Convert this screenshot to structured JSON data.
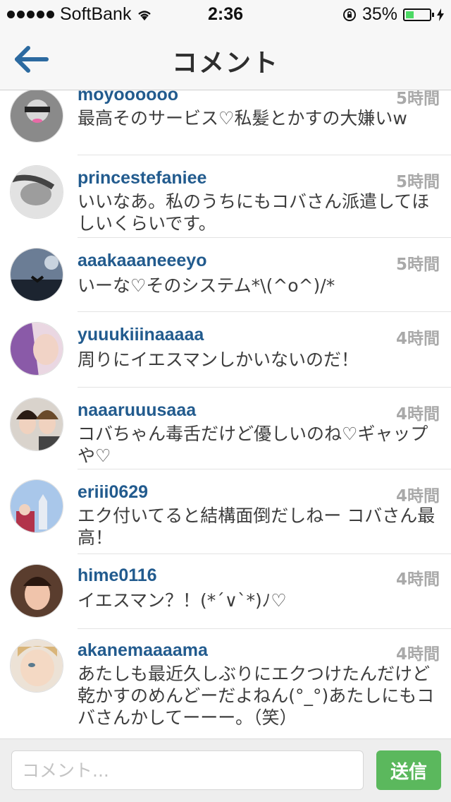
{
  "status_bar": {
    "carrier": "SoftBank",
    "time": "2:36",
    "battery_percent": "35%",
    "battery_level": 0.35
  },
  "nav": {
    "title": "コメント"
  },
  "comments": [
    {
      "username": "moyoooooo",
      "time": "5時間",
      "text": "最高そのサービス♡私髪とかすの大嫌いw"
    },
    {
      "username": "princestefaniee",
      "time": "5時間",
      "text": "いいなあ。私のうちにもコバさん派遣してほしいくらいです。"
    },
    {
      "username": "aaakaaaneeeyo",
      "time": "5時間",
      "text": "いーな♡そのシステム*\\(^o^)/*"
    },
    {
      "username": "yuuukiiinaaaaa",
      "time": "4時間",
      "text": "周りにイエスマンしかいないのだ！"
    },
    {
      "username": "naaaruuusaaa",
      "time": "4時間",
      "text": "コバちゃん毒舌だけど優しいのね♡ギャップや♡"
    },
    {
      "username": "eriii0629",
      "time": "4時間",
      "text": "エク付いてると結構面倒だしねー コバさん最高！"
    },
    {
      "username": "hime0116",
      "time": "4時間",
      "text": "イエスマン？！(*´∨`*)ﾉ♡"
    },
    {
      "username": "akanemaaaama",
      "time": "4時間",
      "text": "あたしも最近久しぶりにエクつけたんだけど乾かすのめんどーだよねん(°_°)あたしにもコバさんかしてーーー。（笑）"
    }
  ],
  "input_bar": {
    "placeholder": "コメント...",
    "send_label": "送信"
  },
  "colors": {
    "username": "#225b8e",
    "send_button": "#5bb85d",
    "back_arrow": "#2c6aa0"
  }
}
